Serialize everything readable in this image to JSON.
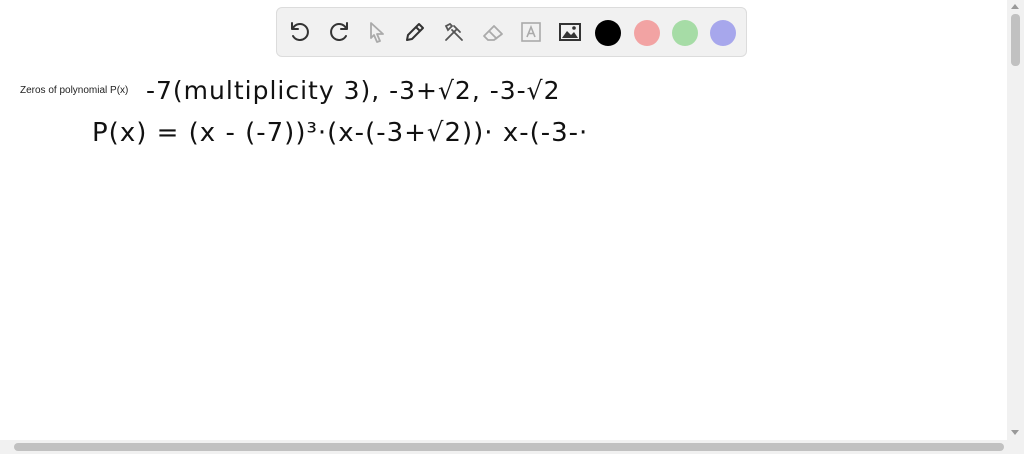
{
  "toolbar": {
    "tools": [
      {
        "name": "undo-icon"
      },
      {
        "name": "redo-icon"
      },
      {
        "name": "pointer-icon"
      },
      {
        "name": "pen-icon"
      },
      {
        "name": "tools-icon"
      },
      {
        "name": "eraser-icon"
      },
      {
        "name": "text-icon"
      },
      {
        "name": "image-icon"
      }
    ],
    "colors": [
      "#000000",
      "#f2a3a3",
      "#a6dca6",
      "#a7a7ec"
    ]
  },
  "canvas": {
    "label": "Zeros of polynomial P(x)",
    "handwriting_line1": "-7(multiplicity 3), -3+√2, -3-√2",
    "handwriting_line2": "P(x) = (x - (-7))³·(x-(-3+√2))· x-(-3-·"
  }
}
